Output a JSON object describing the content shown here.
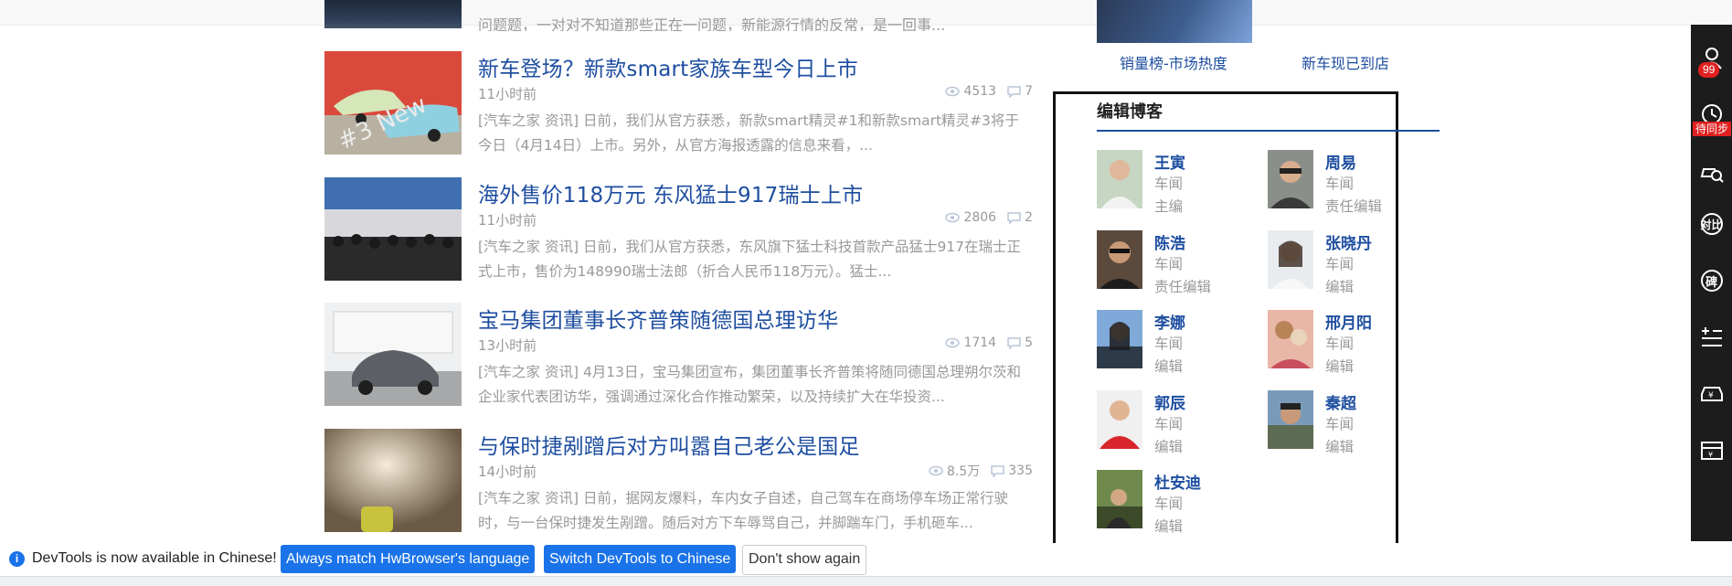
{
  "articles_top_cut": {
    "summary": "问题题，一对对不知道那些正在一问题，新能源行情的反常，是一回事..."
  },
  "articles": [
    {
      "title": "新车登场？新款smart家族车型今日上市",
      "time": "11小时前",
      "views": "4513",
      "comments": "7",
      "summary": "[汽车之家 资讯] 日前，我们从官方获悉，新款smart精灵#1和新款smart精灵#3将于今日（4月14日）上市。另外，从官方海报透露的信息来看，..."
    },
    {
      "title": "海外售价118万元 东风猛士917瑞士上市",
      "time": "11小时前",
      "views": "2806",
      "comments": "2",
      "summary": "[汽车之家 资讯] 日前，我们从官方获悉，东风旗下猛士科技首款产品猛士917在瑞士正式上市，售价为148990瑞士法郎（折合人民币118万元）。猛士..."
    },
    {
      "title": "宝马集团董事长齐普策随德国总理访华",
      "time": "13小时前",
      "views": "1714",
      "comments": "5",
      "summary": "[汽车之家 资讯] 4月13日，宝马集团宣布，集团董事长齐普策将随同德国总理朔尔茨和企业家代表团访华，强调通过深化合作推动繁荣，以及持续扩大在华投资..."
    },
    {
      "title": "与保时捷剐蹭后对方叫嚣自己老公是国足",
      "time": "14小时前",
      "views": "8.5万",
      "comments": "335",
      "summary": "[汽车之家 资讯] 日前，据网友爆料，车内女子自述，自己驾车在商场停车场正常行驶时，与一台保时捷发生剐蹭。随后对方下车辱骂自己，并脚踹车门，手机砸车..."
    }
  ],
  "right_links": {
    "sales_rank": "销量榜-市场热度",
    "new_cars": "新车现已到店"
  },
  "blog": {
    "title": "编辑博客",
    "editors": [
      {
        "name": "王寅",
        "dept": "车闻",
        "role": "主编"
      },
      {
        "name": "周易",
        "dept": "车闻",
        "role": "责任编辑"
      },
      {
        "name": "陈浩",
        "dept": "车闻",
        "role": "责任编辑"
      },
      {
        "name": "张晓丹",
        "dept": "车闻",
        "role": "编辑"
      },
      {
        "name": "李娜",
        "dept": "车闻",
        "role": "编辑"
      },
      {
        "name": "邢月阳",
        "dept": "车闻",
        "role": "编辑"
      },
      {
        "name": "郭辰",
        "dept": "车闻",
        "role": "编辑"
      },
      {
        "name": "秦超",
        "dept": "车闻",
        "role": "编辑"
      },
      {
        "name": "杜安迪",
        "dept": "车闻",
        "role": "编辑"
      }
    ]
  },
  "toolbar": {
    "badge": "99",
    "sync_label": "待同步",
    "compare": "对比",
    "reputation": "碑",
    "items": [
      "user-icon",
      "history-icon",
      "search-car-icon",
      "compare-icon",
      "reputation-icon",
      "add-list-icon",
      "car-price-icon",
      "wallet-icon"
    ]
  },
  "devtools": {
    "message": "DevTools is now available in Chinese!",
    "btn_match": "Always match HwBrowser's language",
    "btn_switch": "Switch DevTools to Chinese",
    "btn_dismiss": "Don't show again"
  }
}
